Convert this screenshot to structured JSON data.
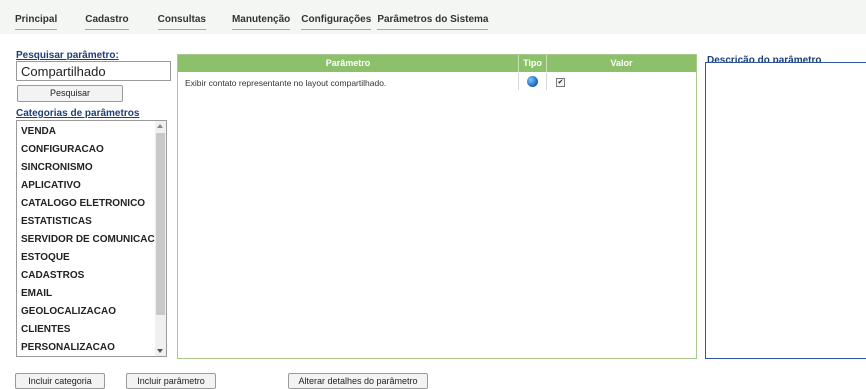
{
  "nav": {
    "items": [
      "Principal",
      "Cadastro",
      "Consultas",
      "Manutenção",
      "Configurações",
      "Parâmetros do Sistema"
    ]
  },
  "search": {
    "label": "Pesquisar parâmetro:",
    "value": "Compartilhado",
    "button_label": "Pesquisar"
  },
  "categories": {
    "label": "Categorias de parâmetros",
    "items": [
      "VENDA",
      "CONFIGURACAO",
      "SINCRONISMO",
      "APLICATIVO",
      "CATALOGO ELETRONICO",
      "ESTATISTICAS",
      "SERVIDOR DE COMUNICACAO",
      "ESTOQUE",
      "CADASTROS",
      "EMAIL",
      "GEOLOCALIZACAO",
      "CLIENTES",
      "PERSONALIZACAO"
    ]
  },
  "grid": {
    "columns": [
      "Parâmetro",
      "Tipo",
      "Valor"
    ],
    "rows": [
      {
        "parametro": "Exibir contato representante no layout compartilhado.",
        "tipo_icon": "globe-icon",
        "valor": true
      }
    ]
  },
  "description": {
    "label": "Descrição do parâmetro"
  },
  "actions": {
    "add_category": "Incluir categoria",
    "add_parameter": "Incluir parâmetro",
    "edit_parameter": "Alterar detalhes do parâmetro"
  },
  "colors": {
    "header_green": "#8cc06b",
    "label_blue": "#1c3f7a",
    "description_border": "#2f57a0"
  }
}
